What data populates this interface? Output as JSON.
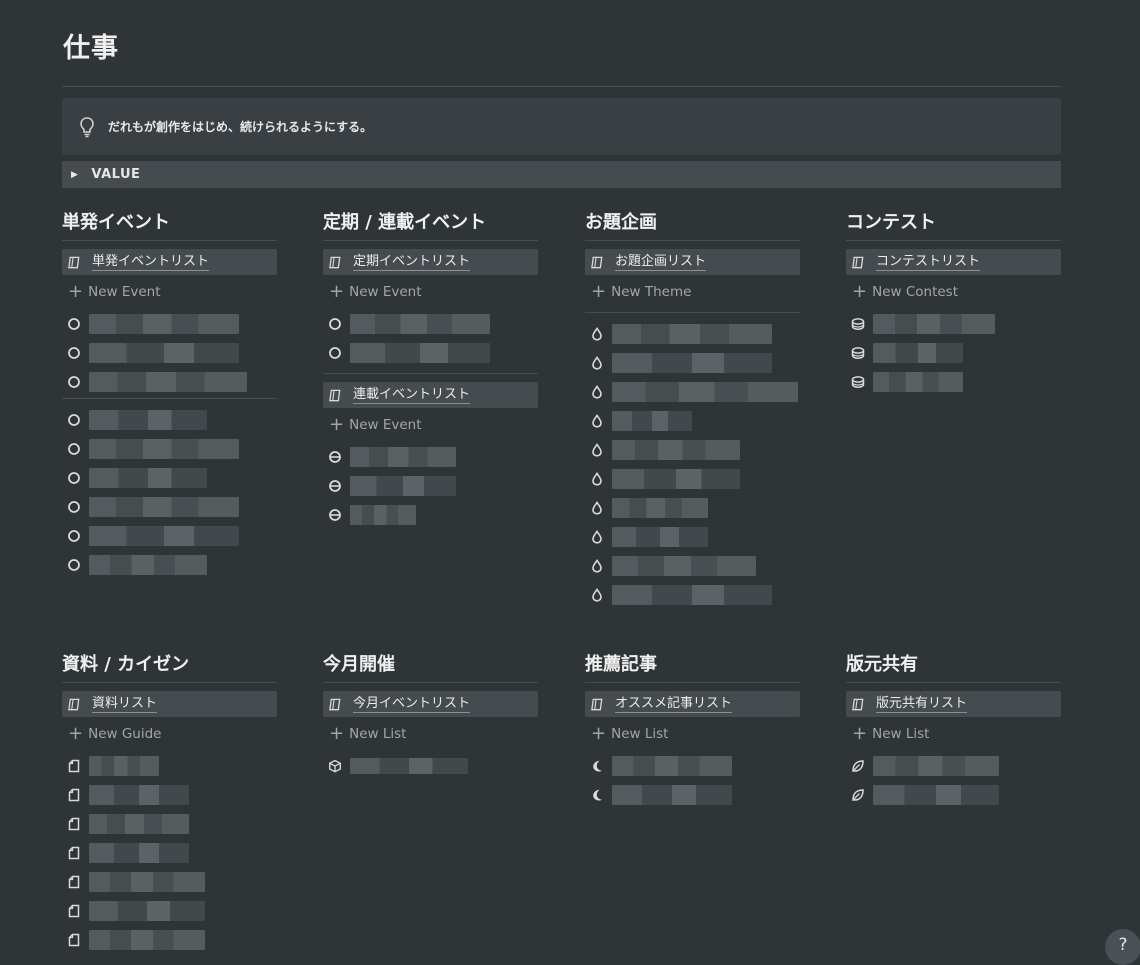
{
  "page": {
    "title": "仕事"
  },
  "callout": {
    "icon": "lightbulb-icon",
    "text": "だれもが創作をはじめ、続けられるようにする。"
  },
  "toggle": {
    "label": "VALUE",
    "icon": "triangle-right-icon"
  },
  "columns": [
    {
      "heading": "単発イベント",
      "db_title": "単発イベントリスト",
      "new_label": "New Event",
      "item_icon": "circle-outline-icon"
    },
    {
      "heading": "定期 / 連載イベント",
      "db_title": "定期イベントリスト",
      "new_label": "New Event",
      "item_icon": "circle-outline-icon",
      "db2_title": "連載イベントリスト",
      "new2_label": "New Event",
      "item2_icon": "half-circle-icon"
    },
    {
      "heading": "お題企画",
      "db_title": "お題企画リスト",
      "new_label": "New Theme",
      "item_icon": "droplet-icon"
    },
    {
      "heading": "コンテスト",
      "db_title": "コンテストリスト",
      "new_label": "New Contest",
      "item_icon": "coin-stack-icon"
    },
    {
      "heading": "資料 / カイゼン",
      "db_title": "資料リスト",
      "new_label": "New Guide",
      "item_icon": "document-icon"
    },
    {
      "heading": "今月開催",
      "db_title": "今月イベントリスト",
      "new_label": "New List",
      "item_icon": "cube-icon"
    },
    {
      "heading": "推薦記事",
      "db_title": "オススメ記事リスト",
      "new_label": "New List",
      "item_icon": "moon-icon"
    },
    {
      "heading": "版元共有",
      "db_title": "版元共有リスト",
      "new_label": "New List",
      "item_icon": "leaf-icon"
    }
  ],
  "help": {
    "label": "?"
  },
  "colors": {
    "background": "#2f3437",
    "panel": "#3a3f43",
    "bar": "#454b4f",
    "text": "#e6e6e6",
    "muted": "#a3a6a8"
  }
}
